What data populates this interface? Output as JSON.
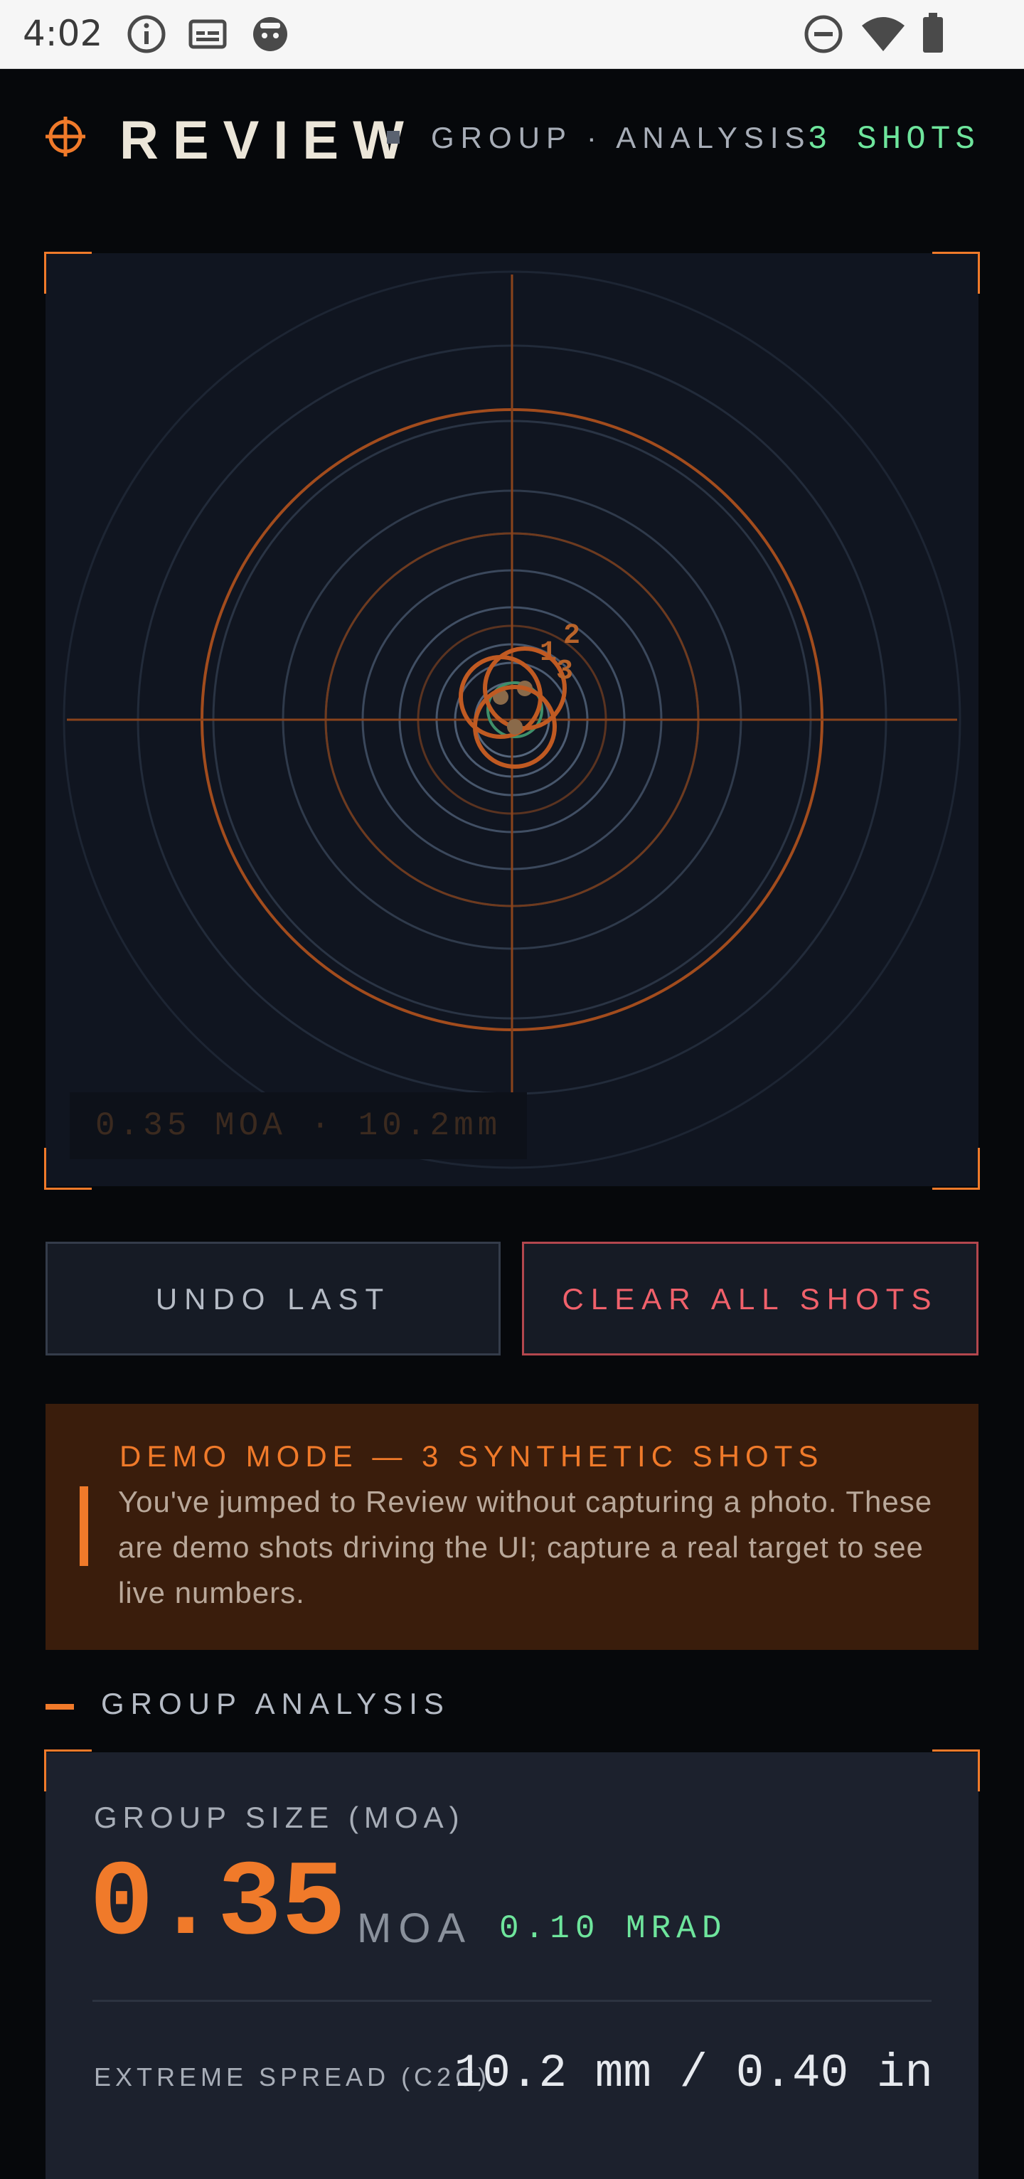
{
  "status_bar": {
    "time": "4:02"
  },
  "header": {
    "title": "REVIEW",
    "subtitle": "GROUP · ANALYSIS",
    "shots_count": "3 SHOTS"
  },
  "target": {
    "readout": "0.35 MOA · 10.2mm",
    "shots": [
      {
        "label": "1"
      },
      {
        "label": "2"
      },
      {
        "label": "3"
      }
    ]
  },
  "actions": {
    "undo_label": "UNDO LAST",
    "clear_label": "CLEAR ALL SHOTS"
  },
  "demo_banner": {
    "title": "DEMO MODE — 3 SYNTHETIC SHOTS",
    "body": "You've jumped to Review without capturing a photo. These are demo shots driving the UI; capture a real target to see live numbers."
  },
  "section": {
    "label": "GROUP ANALYSIS"
  },
  "analysis": {
    "group_size_label": "GROUP SIZE (MOA)",
    "group_size_value": "0.35",
    "group_size_unit": "MOA",
    "group_size_mrad": "0.10 MRAD",
    "extreme_spread_label": "EXTREME SPREAD (C2C)",
    "extreme_spread_value": "10.2 mm / 0.40 in"
  },
  "colors": {
    "accent": "#f07a2a",
    "positive": "#6ee59c",
    "danger": "#f0616b",
    "background": "#06080b",
    "panel": "#101520"
  }
}
